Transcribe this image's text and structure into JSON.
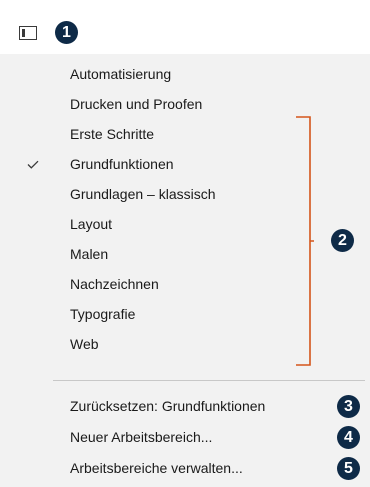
{
  "callouts": [
    "1",
    "2",
    "3",
    "4",
    "5"
  ],
  "workspaces": [
    {
      "label": "Automatisierung",
      "checked": false
    },
    {
      "label": "Drucken und Proofen",
      "checked": false
    },
    {
      "label": "Erste Schritte",
      "checked": false
    },
    {
      "label": "Grundfunktionen",
      "checked": true
    },
    {
      "label": "Grundlagen – klassisch",
      "checked": false
    },
    {
      "label": "Layout",
      "checked": false
    },
    {
      "label": "Malen",
      "checked": false
    },
    {
      "label": "Nachzeichnen",
      "checked": false
    },
    {
      "label": "Typografie",
      "checked": false
    },
    {
      "label": "Web",
      "checked": false
    }
  ],
  "actions": {
    "reset": "Zurücksetzen: Grundfunktionen",
    "new": "Neuer Arbeitsbereich...",
    "manage": "Arbeitsbereiche verwalten..."
  },
  "colors": {
    "callout": "#0e2a47",
    "bracket": "#d4551a",
    "menu_bg": "#f2f2f2"
  },
  "icons": {
    "workspace_switcher": "workspace-switcher-icon",
    "check": "checkmark-icon"
  }
}
